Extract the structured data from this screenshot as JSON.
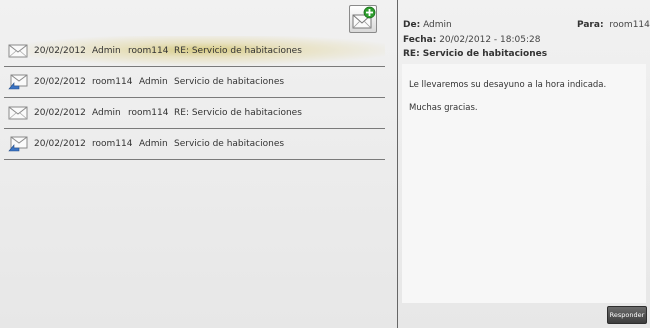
{
  "compose": {
    "icon": "new-mail-icon"
  },
  "messages": [
    {
      "date": "20/02/2012",
      "from": "Admin",
      "to": "room114",
      "subject": "RE: Servicio de habitaciones",
      "icon": "envelope-icon",
      "selected": true
    },
    {
      "date": "20/02/2012",
      "from": "room114",
      "to": "Admin",
      "subject": "Servicio de habitaciones",
      "icon": "envelope-sent-icon",
      "selected": false
    },
    {
      "date": "20/02/2012",
      "from": "Admin",
      "to": "room114",
      "subject": "RE: Servicio de habitaciones",
      "icon": "envelope-icon",
      "selected": false
    },
    {
      "date": "20/02/2012",
      "from": "room114",
      "to": "Admin",
      "subject": "Servicio de habitaciones",
      "icon": "envelope-sent-icon",
      "selected": false
    }
  ],
  "detail": {
    "from_label": "De:",
    "from_value": "Admin",
    "to_label": "Para:",
    "to_value": "room114",
    "date_label": "Fecha:",
    "date_value": "20/02/2012 - 18:05:28",
    "subject": "RE: Servicio de habitaciones",
    "body": [
      "Le llevaremos su desayuno a la hora indicada.",
      "Muchas gracias."
    ],
    "reply_label": "Responder"
  },
  "colors": {
    "selected_highlight": "#d6ca80",
    "reply_button": "#4a4a4a",
    "compose_plus": "#2e9e2e"
  }
}
